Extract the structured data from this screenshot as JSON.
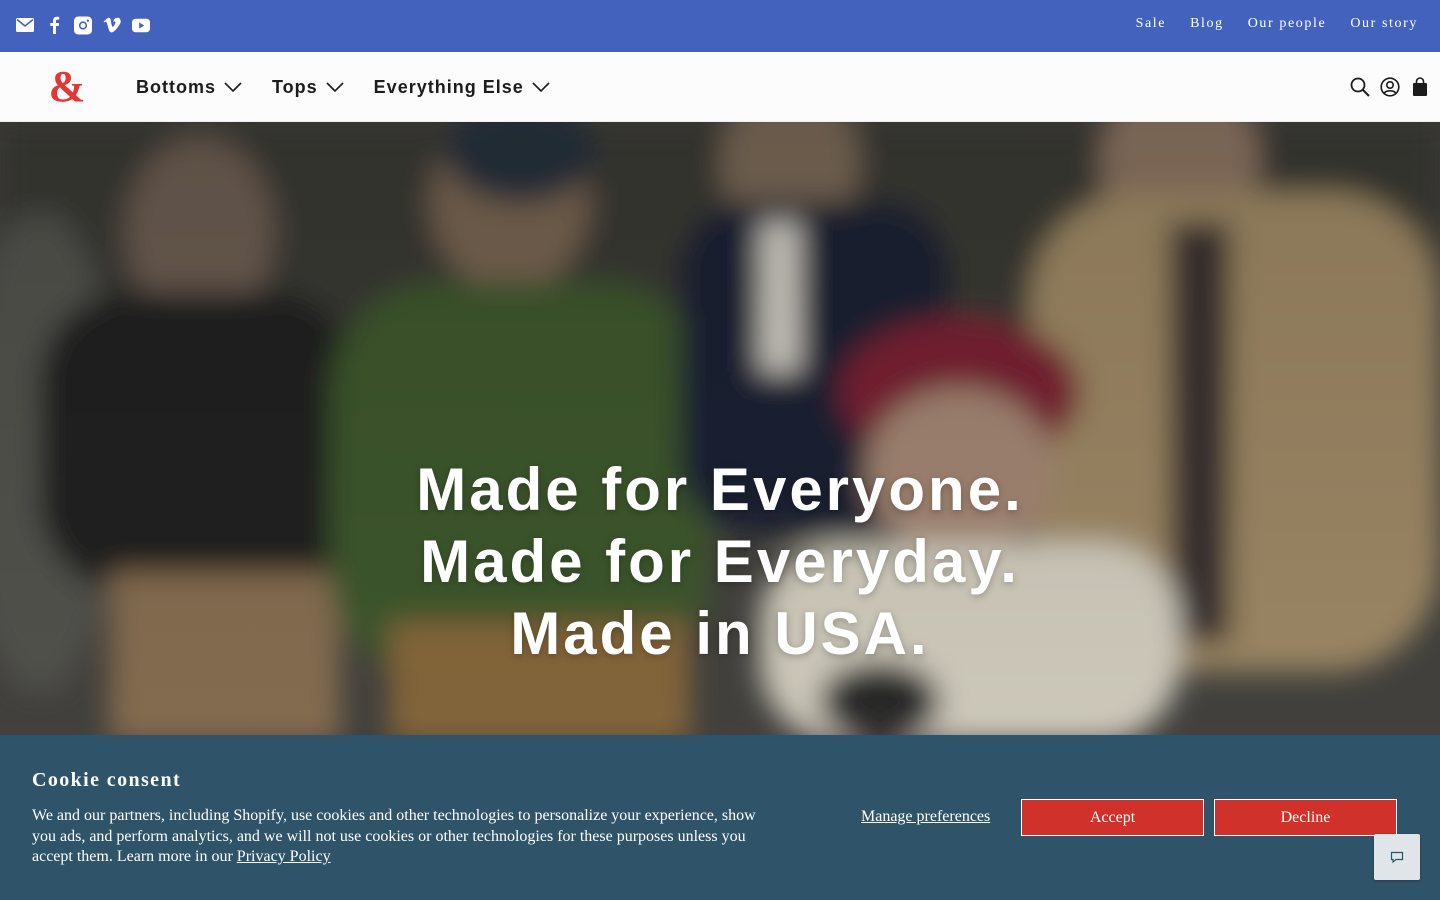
{
  "topbar": {
    "social": [
      {
        "icon": "mail-icon"
      },
      {
        "icon": "facebook-icon"
      },
      {
        "icon": "instagram-icon"
      },
      {
        "icon": "vimeo-icon"
      },
      {
        "icon": "youtube-icon"
      }
    ],
    "links": [
      "Sale",
      "Blog",
      "Our people",
      "Our story"
    ],
    "bg_color": "#4262bd"
  },
  "header": {
    "logo": "ampersand-logo",
    "nav": [
      {
        "label": "Bottoms"
      },
      {
        "label": "Tops"
      },
      {
        "label": "Everything Else"
      }
    ],
    "icons": [
      "search-icon",
      "account-icon",
      "cart-icon"
    ]
  },
  "hero": {
    "lines": [
      "Made for Everyone.",
      "Made for Everyday.",
      "Made in USA."
    ]
  },
  "cookie": {
    "title": "Cookie consent",
    "body": "We and our partners, including Shopify, use cookies and other technologies to personalize your experience, show you ads, and perform analytics, and we will not use cookies or other technologies for these purposes unless you accept them. Learn more in our ",
    "privacy_link": "Privacy Policy",
    "manage": "Manage preferences",
    "accept": "Accept",
    "decline": "Decline",
    "bg_color": "#2f5469",
    "button_color": "#d0322b"
  },
  "chat": {
    "icon": "chat-icon"
  }
}
